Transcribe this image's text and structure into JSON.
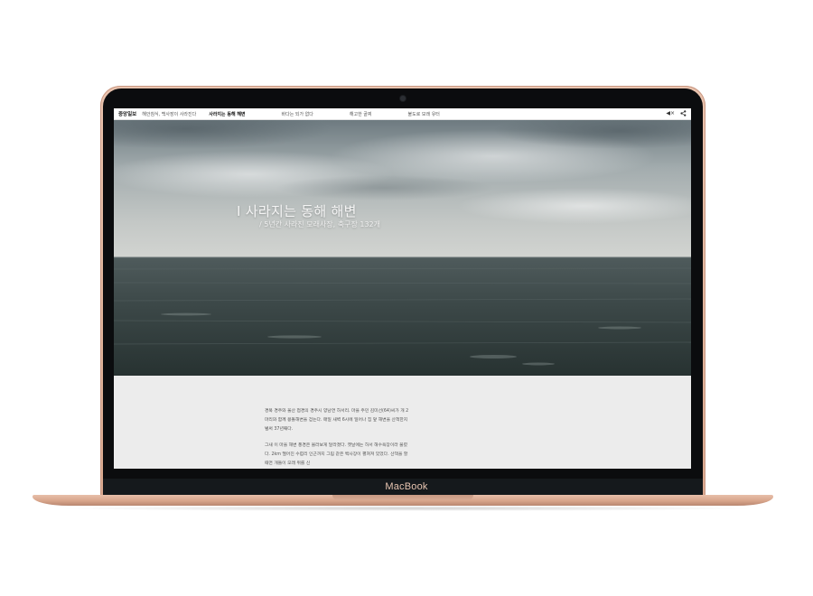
{
  "device": {
    "brand": "MacBook"
  },
  "site": {
    "logo": "중앙일보",
    "series": "해안침식, 백사장이 사라진다",
    "nav": [
      {
        "label": "사라지는 동해 해변",
        "active": true
      },
      {
        "label": "바다는 되가 없다",
        "active": false
      },
      {
        "label": "해고한 골찌",
        "active": false
      },
      {
        "label": "불도로 모래 유터",
        "active": false
      }
    ],
    "tools": {
      "sound": "◀×",
      "share": "⋖"
    }
  },
  "hero": {
    "title": "I 사라지는 동해 해변",
    "subtitle": "/ 5년간 사라진 모래사장, 축구장 132개"
  },
  "article": {
    "paragraphs": [
      "경북 경주와 울산 접경의 경주시 양남면 하서리. 마을 주민 김미선(64)씨가 개 2마리와 함께 몽돌해변을 걷는다. 매일 새벽 6시에 일어나 집 앞 해변을 산책한지 벌써 37년째다.",
      "그새 이 마을 해변 풍경은 몰라보게 달라졌다. 옛날에는 하서 해수욕장이라 불렸다. 2km 떨어진 수렴리 인근까지 그림 같은 백사장이 펼쳐져 있었다. 산책을 할 때면 개들이 모래 위를 신"
    ]
  }
}
